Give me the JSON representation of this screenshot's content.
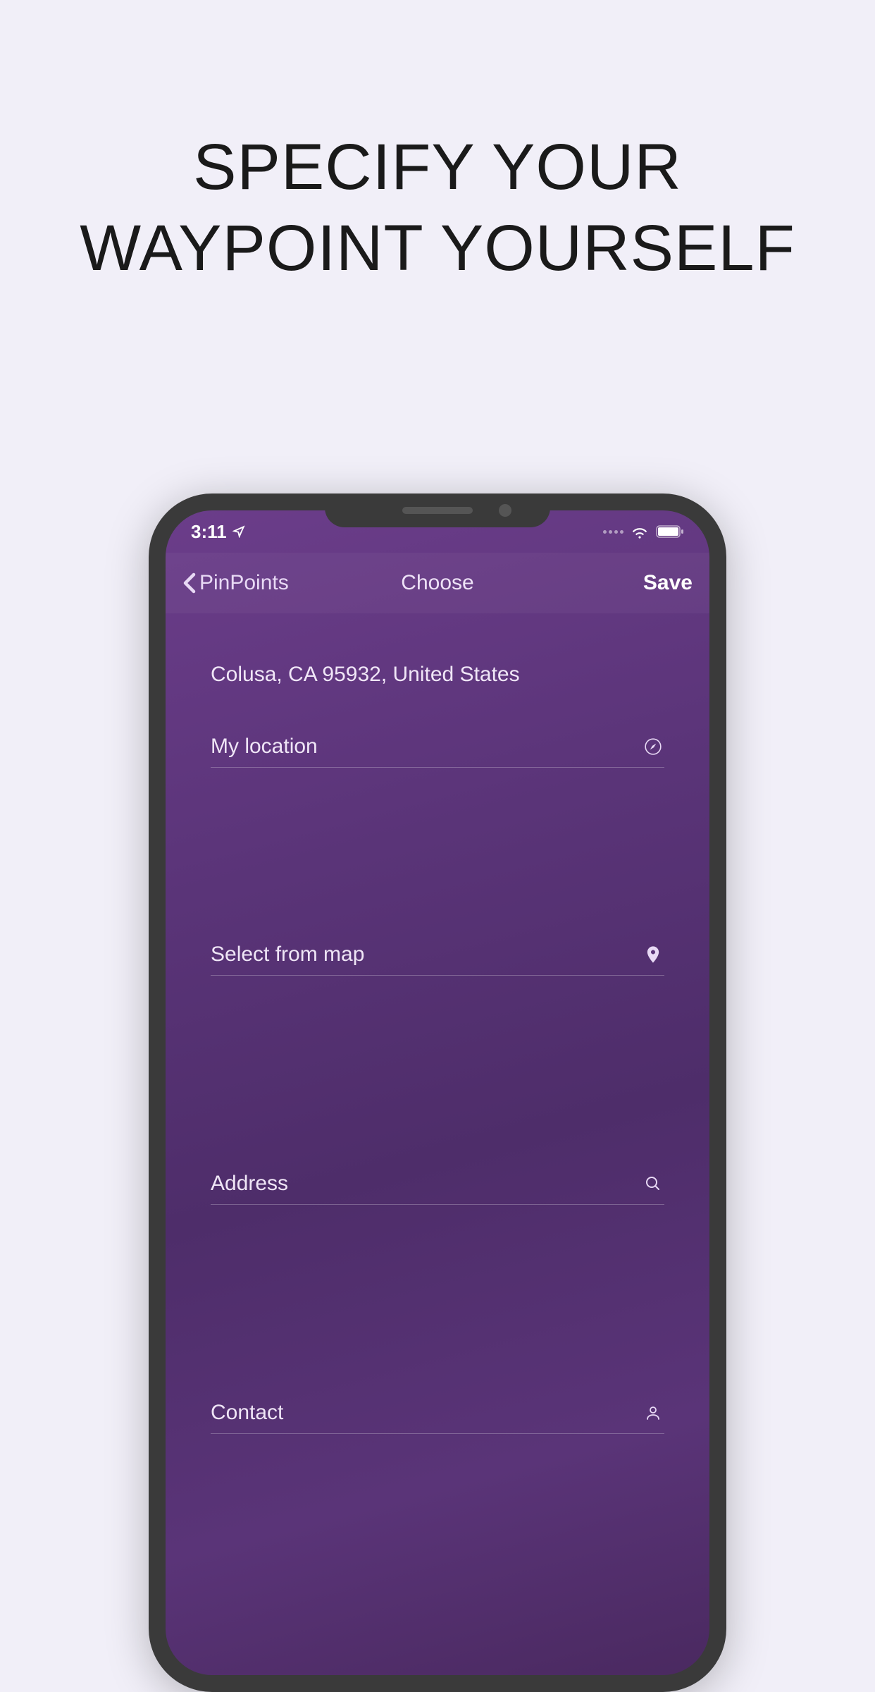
{
  "headline": "SPECIFY YOUR WAYPOINT YOURSELF",
  "status": {
    "time": "3:11",
    "location_active": true
  },
  "nav": {
    "back_label": "PinPoints",
    "title": "Choose",
    "save_label": "Save"
  },
  "address": {
    "current": "Colusa, CA  95932, United States"
  },
  "options": {
    "my_location": "My location",
    "select_from_map": "Select from map",
    "address": "Address",
    "contact": "Contact"
  }
}
